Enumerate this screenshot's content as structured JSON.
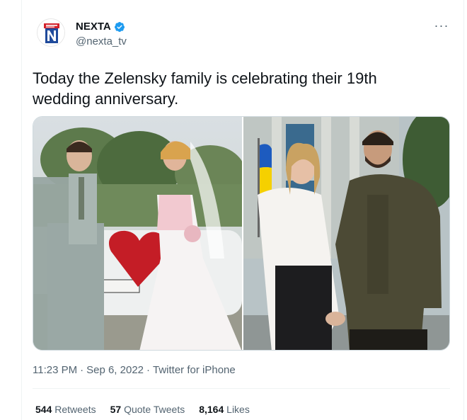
{
  "author": {
    "display_name": "NEXTA",
    "handle": "@nexta_tv",
    "verified": true,
    "avatar_icon": "nexta-logo-icon",
    "avatar_letter": "N"
  },
  "tweet": {
    "text": "Today the Zelensky family is celebrating their 19th wedding anniversary."
  },
  "media": {
    "photo_count": 2
  },
  "meta": {
    "time": "11:23 PM",
    "date": "Sep 6, 2022",
    "source": "Twitter for iPhone",
    "separator": "·"
  },
  "stats": {
    "retweets_count": "544",
    "retweets_label": "Retweets",
    "quotes_count": "57",
    "quotes_label": "Quote Tweets",
    "likes_count": "8,164",
    "likes_label": "Likes"
  },
  "colors": {
    "text_primary": "#0f1419",
    "text_secondary": "#536471",
    "verified_blue": "#1d9bf0",
    "brand_red": "#d3202a",
    "brand_blue": "#1f4a9b",
    "border": "#cfd9de"
  },
  "more_label": "···"
}
